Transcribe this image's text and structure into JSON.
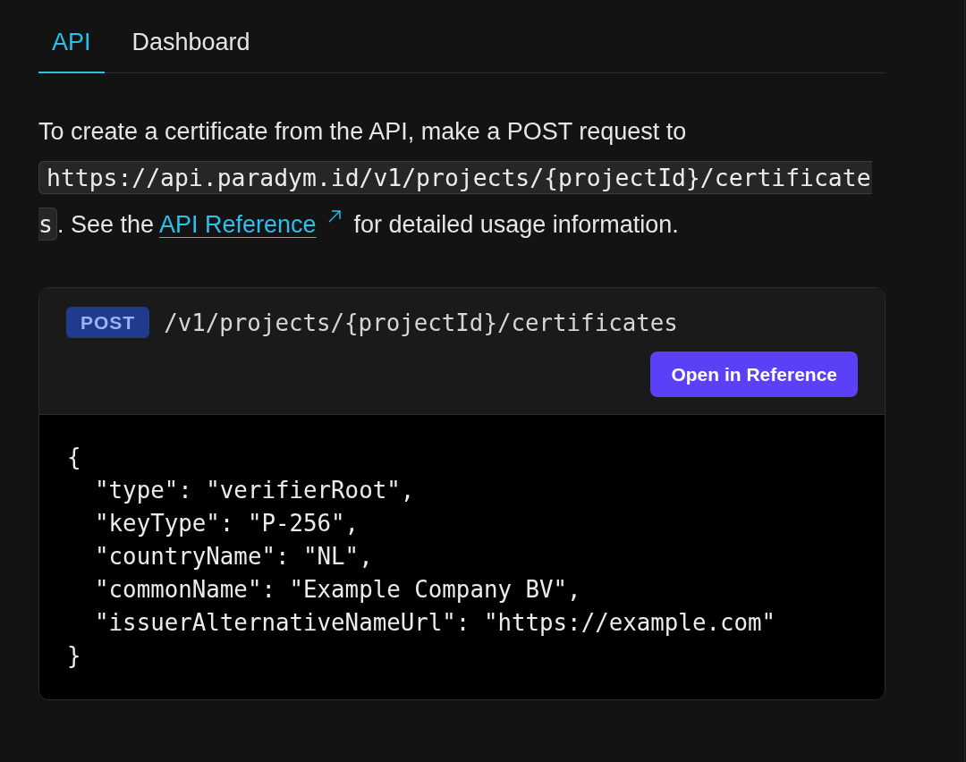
{
  "tabs": [
    {
      "label": "API",
      "selected": true
    },
    {
      "label": "Dashboard",
      "selected": false
    }
  ],
  "intro": {
    "before": "To create a certificate from the API, make a POST request to",
    "code_fragments": [
      "https://api.paradym.id/v1/projects/{projectId}/certificate",
      "s"
    ],
    "middle": ". See the",
    "link": "API Reference",
    "after": "for detailed usage information."
  },
  "endpoint": {
    "method": "POST",
    "path": "/v1/projects/{projectId}/certificates",
    "button": "Open in Reference"
  },
  "code_lines": [
    "{",
    "  \"type\": \"verifierRoot\",",
    "  \"keyType\": \"P-256\",",
    "  \"countryName\": \"NL\",",
    "  \"commonName\": \"Example Company BV\",",
    "  \"issuerAlternativeNameUrl\": \"https://example.com\"",
    "}"
  ]
}
